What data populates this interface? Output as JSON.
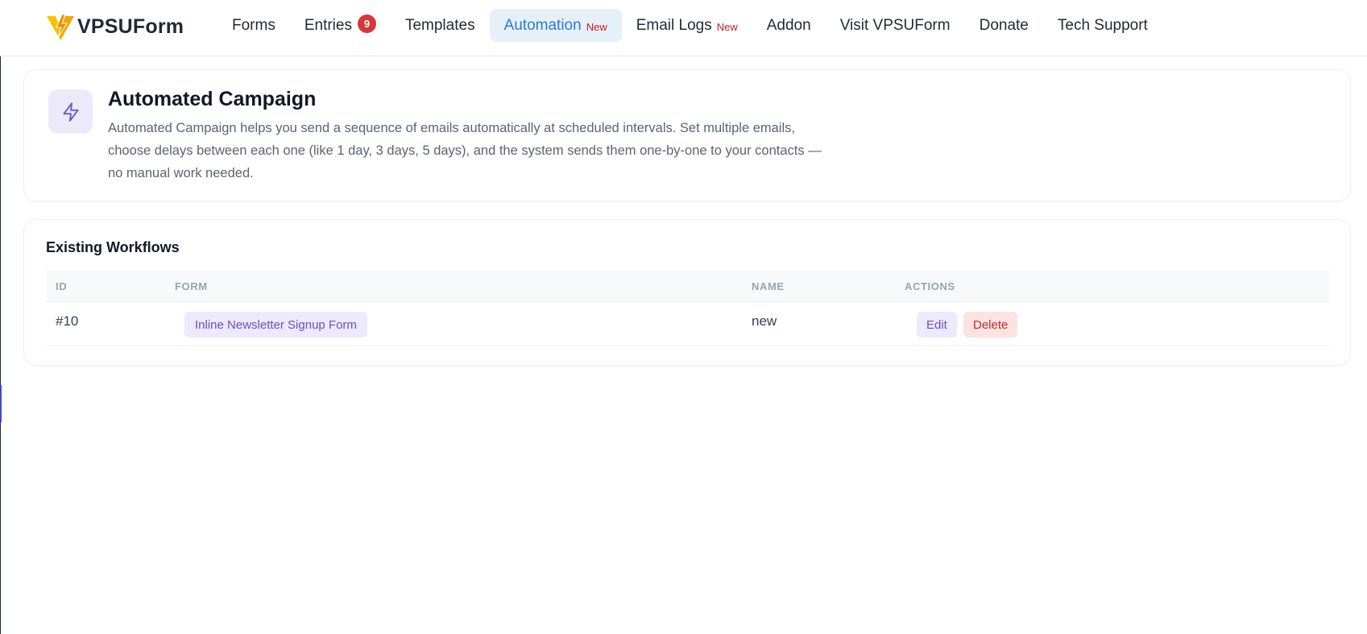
{
  "brand": {
    "name": "VPSUForm",
    "logo_icon": "lightning-v-logo",
    "logo_colors": [
      "#f5c400",
      "#f08c00"
    ]
  },
  "nav": {
    "items": [
      {
        "label": "Forms"
      },
      {
        "label": "Entries",
        "badge": "9"
      },
      {
        "label": "Templates"
      },
      {
        "label": "Automation",
        "tag": "New",
        "active": true
      },
      {
        "label": "Email Logs",
        "tag": "New"
      },
      {
        "label": "Addon"
      },
      {
        "label": "Visit VPSUForm"
      },
      {
        "label": "Donate"
      },
      {
        "label": "Tech Support"
      }
    ]
  },
  "hero": {
    "icon": "lightning-icon",
    "title": "Automated Campaign",
    "description": "Automated Campaign helps you send a sequence of emails automatically at scheduled intervals. Set multiple emails, choose delays between each one (like 1 day, 3 days, 5 days), and the system sends them one-by-one to your contacts — no manual work needed."
  },
  "workflows": {
    "title": "Existing Workflows",
    "columns": [
      "ID",
      "FORM",
      "NAME",
      "ACTIONS"
    ],
    "rows": [
      {
        "id": "#10",
        "form": "Inline Newsletter Signup Form",
        "name": "new",
        "edit_label": "Edit",
        "delete_label": "Delete"
      }
    ]
  },
  "colors": {
    "accent": "#2b7bcb",
    "badge": "#d63638",
    "new_tag": "#d11a1a",
    "purple": "#6d4fc2",
    "danger": "#c62828"
  }
}
